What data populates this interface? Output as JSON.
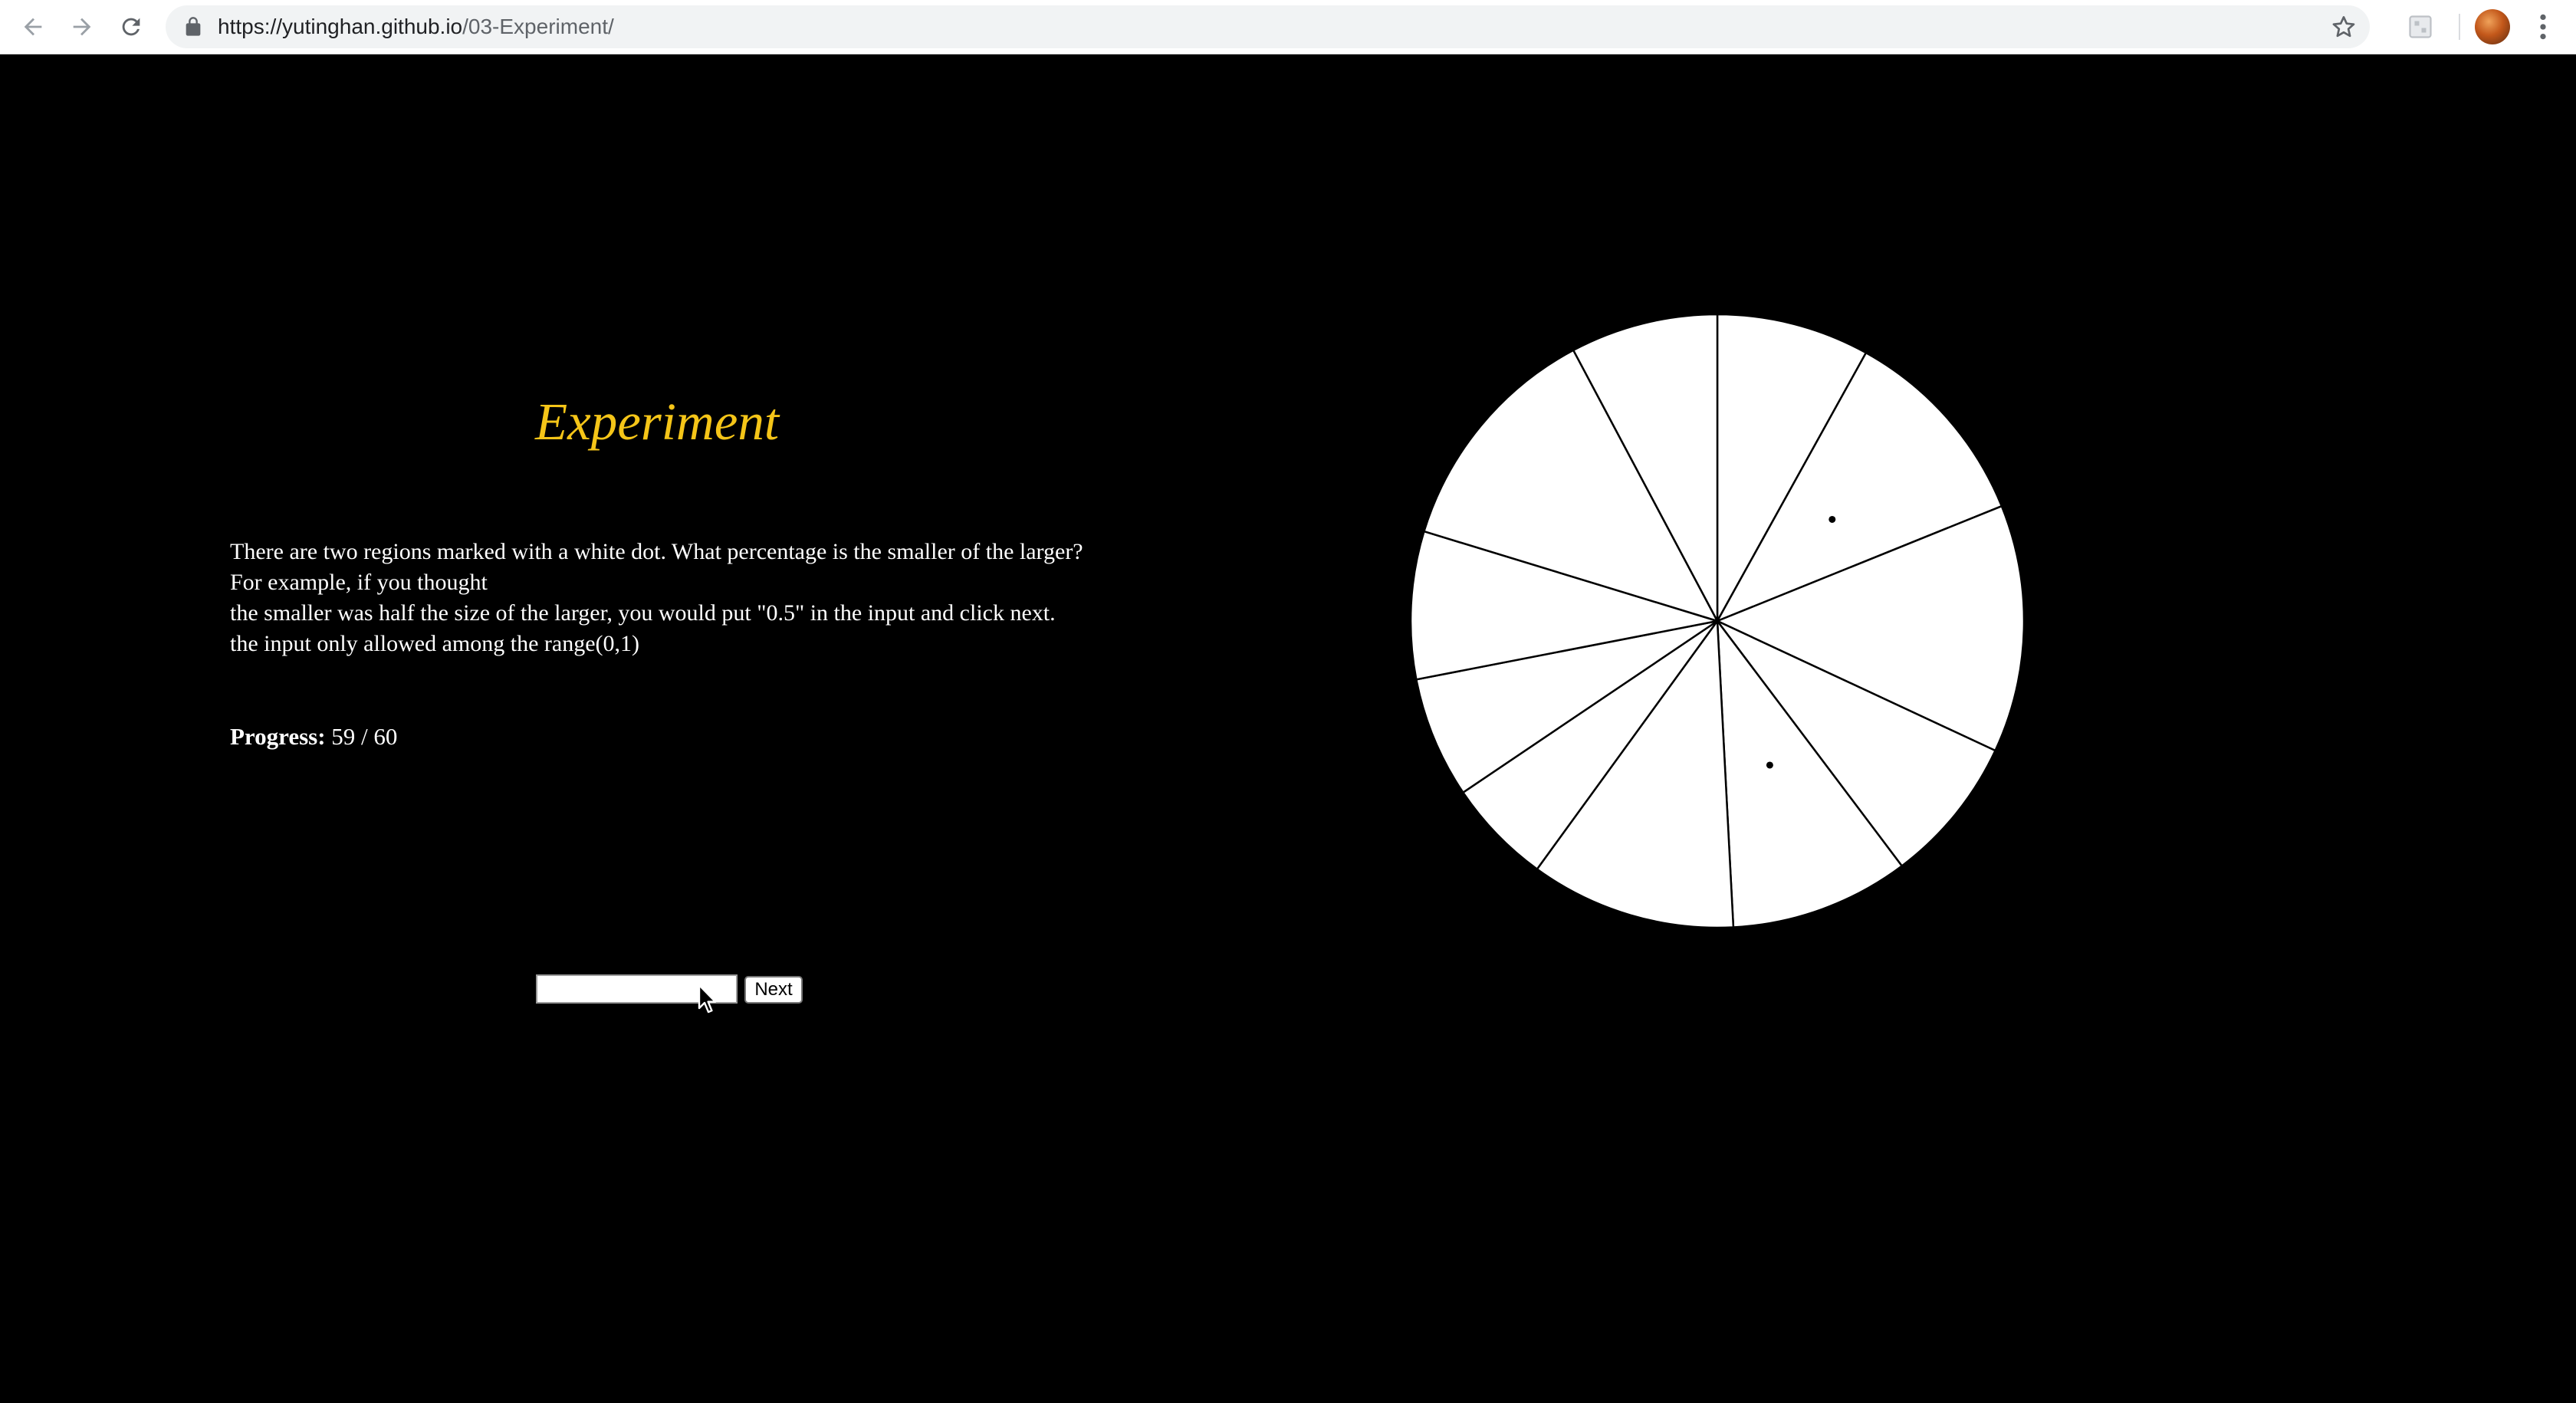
{
  "browser": {
    "url_host": "https://yutinghan.github.io",
    "url_path": "/03-Experiment/",
    "icons": [
      "back-arrow-icon",
      "forward-arrow-icon",
      "reload-icon",
      "lock-icon",
      "star-icon",
      "extension-icon",
      "profile-avatar",
      "menu-dots-icon"
    ]
  },
  "page": {
    "title": "Experiment",
    "instructions": [
      "There are two regions marked with a white dot. What percentage is the smaller of the larger?",
      "For example, if you thought",
      "the smaller was half the size of the larger, you would put \"0.5\" in the input and click next.",
      "the input only allowed among the range(0,1)"
    ],
    "progress_label": "Progress:",
    "progress_value": "59 / 60",
    "answer_input": {
      "value": "",
      "placeholder": ""
    },
    "next_label": "Next"
  },
  "colors": {
    "background": "#000000",
    "title": "#f5c518",
    "text": "#ffffff",
    "pie_fill": "#ffffff",
    "pie_stroke": "#000000"
  },
  "chart_data": {
    "type": "pie",
    "title": "",
    "boundaries_deg_clockwise_from_top": [
      0,
      29,
      68,
      115,
      143,
      177,
      216,
      236,
      259,
      287,
      332
    ],
    "marked_slices": [
      1,
      4
    ]
  }
}
